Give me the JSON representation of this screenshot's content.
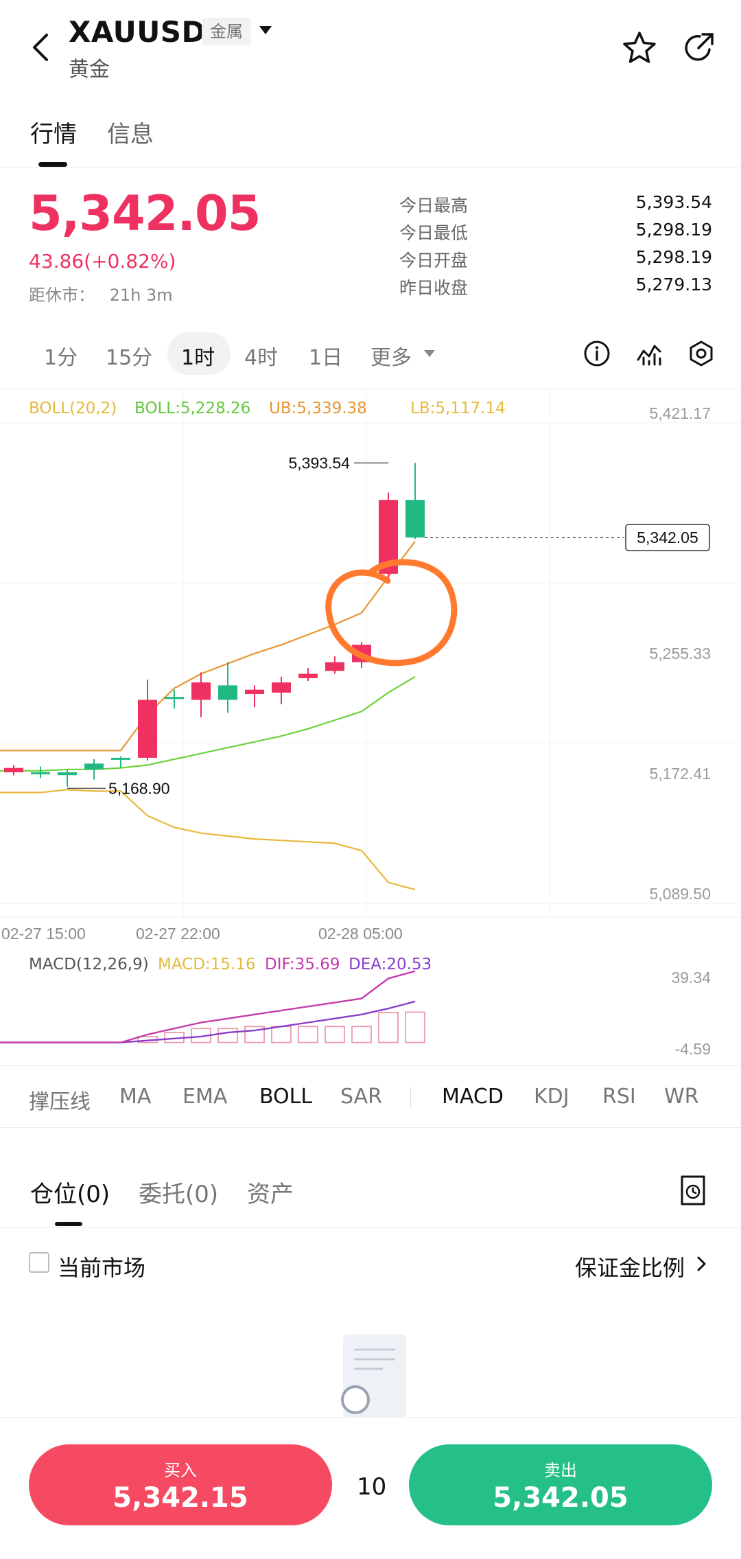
{
  "header": {
    "symbol": "XAUUSD",
    "badge": "金属",
    "name": "黄金"
  },
  "tabs": [
    "行情",
    "信息"
  ],
  "quote": {
    "price": "5,342.05",
    "change": "43.86(+0.82%)",
    "close_in_label": "距休市：",
    "close_in_value": "21h 3m",
    "stats": [
      {
        "label": "今日最高",
        "value": "5,393.54"
      },
      {
        "label": "今日最低",
        "value": "5,298.19"
      },
      {
        "label": "今日开盘",
        "value": "5,298.19"
      },
      {
        "label": "昨日收盘",
        "value": "5,279.13"
      }
    ]
  },
  "intervals": {
    "items": [
      "1分",
      "15分",
      "1时",
      "4时",
      "1日",
      "更多"
    ],
    "active": "1时"
  },
  "chart": {
    "legend": {
      "boll": "BOLL(20,2)",
      "mid": "BOLL:5,228.26",
      "ub": "UB:5,339.38",
      "lb": "LB:5,117.14"
    },
    "macd_legend": {
      "label": "MACD(12,26,9)",
      "macd": "MACD:15.16",
      "dif": "DIF:35.69",
      "dea": "DEA:20.53"
    },
    "y_ticks": [
      "5,421.17",
      "5,255.33",
      "5,172.41",
      "5,089.50"
    ],
    "macd_ticks": [
      "39.34",
      "-4.59"
    ],
    "x_ticks": [
      "02-27 15:00",
      "02-27 22:00",
      "02-28 05:00"
    ],
    "high_label": "5,393.54",
    "low_label": "5,168.90",
    "last_price": "5,342.05",
    "colors": {
      "up": "#ee3160",
      "down": "#22b881",
      "mid": "#6ad23a",
      "ub": "#e8962f",
      "lb": "#e8b83a",
      "dif": "#c23caa",
      "dea": "#8a3ec9",
      "annotation": "#ff7a2f"
    }
  },
  "chart_data": {
    "type": "candlestick",
    "x": [
      "02-27 15:00",
      "02-27 16:00",
      "02-27 17:00",
      "02-27 18:00",
      "02-27 19:00",
      "02-27 20:00",
      "02-27 21:00",
      "02-27 22:00",
      "02-27 23:00",
      "02-28 00:00",
      "02-28 01:00",
      "02-28 02:00",
      "02-28 03:00",
      "02-28 04:00",
      "02-28 05:00",
      "02-28 06:00"
    ],
    "ohlc": [
      [
        5183.0,
        5185.0,
        5178.0,
        5180.0
      ],
      [
        5180.0,
        5184.0,
        5176.0,
        5180.0
      ],
      [
        5178.0,
        5182.0,
        5170.0,
        5180.0
      ],
      [
        5182.0,
        5189.0,
        5175.0,
        5186.0
      ],
      [
        5189.0,
        5191.0,
        5183.0,
        5190.0
      ],
      [
        5230.0,
        5244.0,
        5188.0,
        5190.0
      ],
      [
        5232.0,
        5237.0,
        5224.0,
        5232.0
      ],
      [
        5242.0,
        5249.0,
        5218.0,
        5230.0
      ],
      [
        5230.0,
        5256.0,
        5221.0,
        5240.0
      ],
      [
        5237.0,
        5240.0,
        5225.0,
        5234.0
      ],
      [
        5242.0,
        5246.0,
        5227.0,
        5235.0
      ],
      [
        5248.0,
        5252.0,
        5243.0,
        5245.0
      ],
      [
        5256.0,
        5260.0,
        5248.0,
        5250.0
      ],
      [
        5268.0,
        5270.0,
        5252.0,
        5256.0
      ],
      [
        5368.0,
        5373.0,
        5312.0,
        5317.0
      ],
      [
        5342.05,
        5393.54,
        5341.0,
        5368.0
      ]
    ],
    "boll_mid": [
      5181,
      5181,
      5182,
      5182,
      5183,
      5185,
      5189,
      5193,
      5197,
      5201,
      5205,
      5210,
      5216,
      5222,
      5235,
      5246
    ],
    "boll_ub": [
      5195,
      5195,
      5195,
      5195,
      5195,
      5220,
      5238,
      5248,
      5255,
      5262,
      5268,
      5275,
      5282,
      5290,
      5315,
      5339.38
    ],
    "boll_lb": [
      5166,
      5166,
      5168,
      5167,
      5167,
      5150,
      5142,
      5138,
      5136,
      5134,
      5133,
      5132,
      5131,
      5126,
      5104,
      5099
    ],
    "macd": {
      "dif": [
        0,
        0,
        0,
        0,
        0,
        4,
        7,
        10,
        12,
        14,
        16,
        18,
        20,
        22,
        32,
        35.69
      ],
      "dea": [
        0,
        0,
        0,
        0,
        0,
        1,
        2,
        3,
        5,
        6,
        8,
        10,
        12,
        14,
        17,
        20.53
      ],
      "hist": [
        0,
        0,
        0,
        0,
        0,
        3,
        5,
        7,
        7,
        8,
        8,
        8,
        8,
        8,
        15,
        15.16
      ]
    },
    "ylim": [
      5089.5,
      5421.17
    ],
    "macd_ylim": [
      -4.59,
      39.34
    ]
  },
  "indicators": {
    "main": [
      "撑压线",
      "MA",
      "EMA",
      "BOLL",
      "SAR"
    ],
    "sub": [
      "MACD",
      "KDJ",
      "RSI",
      "WR"
    ],
    "active_main": "BOLL",
    "active_sub": "MACD"
  },
  "positions": {
    "tabs": [
      "仓位(0)",
      "委托(0)",
      "资产"
    ],
    "current_market": "当前市场",
    "margin_ratio": "保证金比例"
  },
  "trade": {
    "buy_label": "买入",
    "buy_price": "5,342.15",
    "quantity": "10",
    "sell_label": "卖出",
    "sell_price": "5,342.05"
  }
}
